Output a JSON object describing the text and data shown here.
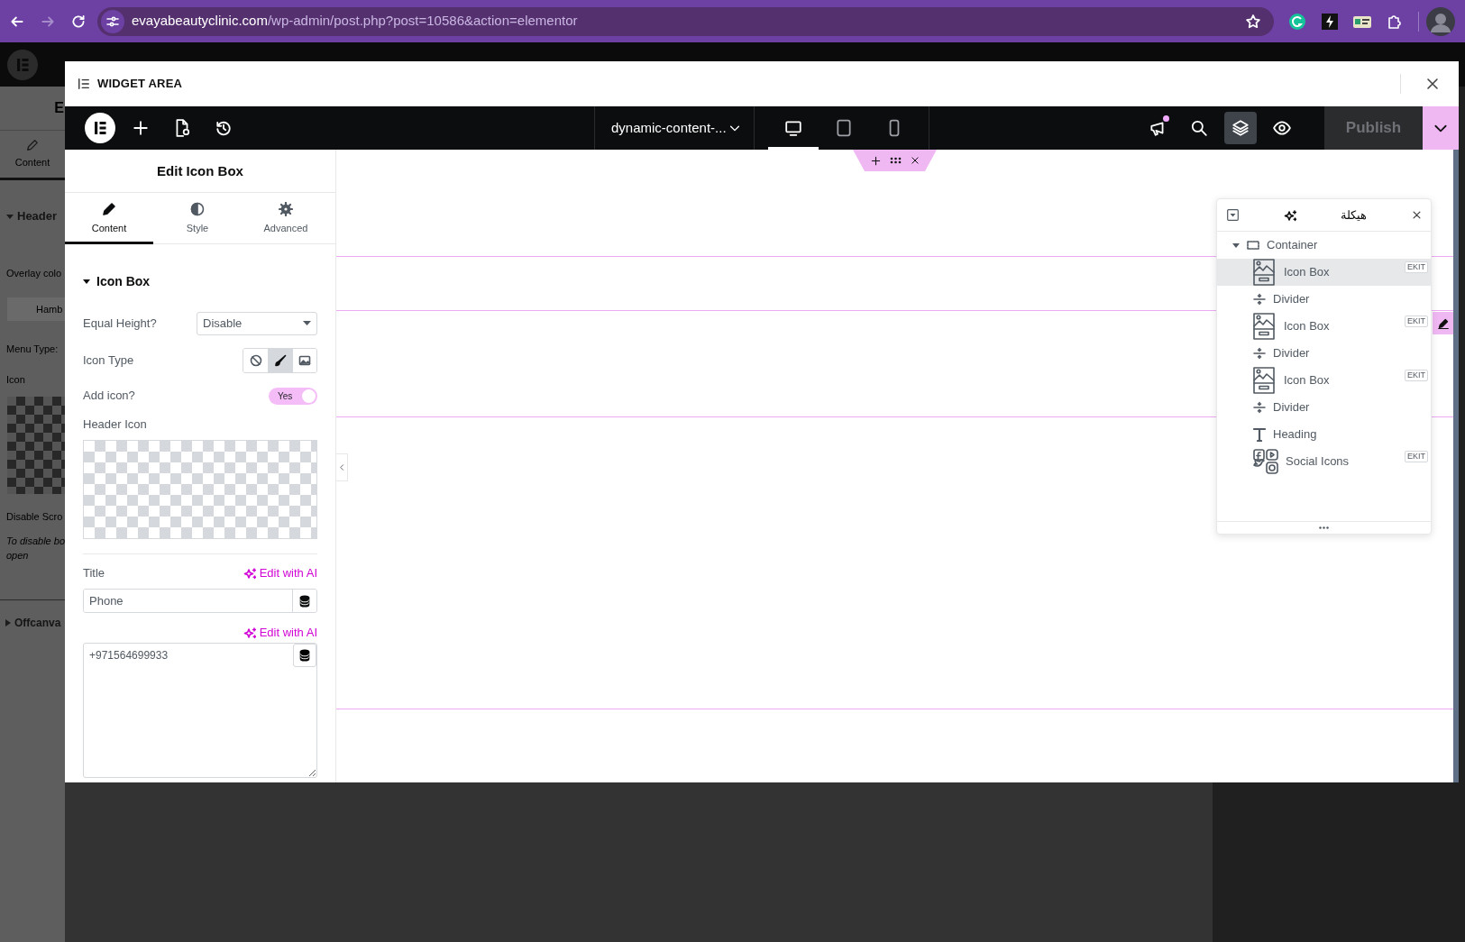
{
  "browser": {
    "url_host": "evayabeautyclinic.com",
    "url_path": "/wp-admin/post.php?post=10586&action=elementor"
  },
  "background_panel": {
    "title": "E",
    "tab": "Content",
    "section": "Header",
    "overlay_label": "Overlay colo",
    "menu_button": "Hamb",
    "menu_type_label": "Menu Type:",
    "icon_label": "Icon",
    "scroll_label": "Disable Scro",
    "hint_lines": [
      "To disable bo",
      "open"
    ],
    "next_section": "Offcanva"
  },
  "modal": {
    "title": "WIDGET AREA"
  },
  "toolbar": {
    "page_name": "dynamic-content-...",
    "devices": [
      {
        "kind": "desktop",
        "selected": true
      },
      {
        "kind": "tablet",
        "selected": false
      },
      {
        "kind": "mobile",
        "selected": false
      }
    ],
    "tools": [
      {
        "kind": "announcements",
        "badge": true,
        "selected": false
      },
      {
        "kind": "search",
        "badge": false,
        "selected": false
      },
      {
        "kind": "structure",
        "badge": false,
        "selected": true
      },
      {
        "kind": "preview",
        "badge": false,
        "selected": false
      }
    ],
    "publish": {
      "label": "Publish",
      "disabled": true
    }
  },
  "panel": {
    "title": "Edit Icon Box",
    "tabs": [
      {
        "label": "Content",
        "kind": "content",
        "selected": true
      },
      {
        "label": "Style",
        "kind": "style",
        "selected": false
      },
      {
        "label": "Advanced",
        "kind": "advanced",
        "selected": false
      }
    ],
    "section": {
      "title": "Icon Box",
      "expanded": true
    },
    "controls": [
      {
        "kind": "select",
        "label": "Equal Height?",
        "value": "Disable"
      },
      {
        "kind": "choices",
        "label": "Icon Type",
        "options": [
          {
            "kind": "none",
            "selected": false
          },
          {
            "kind": "icon",
            "selected": true
          },
          {
            "kind": "image",
            "selected": false
          }
        ]
      },
      {
        "kind": "switch",
        "label": "Add icon?",
        "on": true,
        "on_text": "Yes"
      },
      {
        "kind": "media",
        "label": "Header Icon"
      },
      {
        "kind": "text",
        "label": "Title",
        "ai_link": "Edit with AI",
        "value": "Phone"
      },
      {
        "kind": "textarea",
        "ai_link": "Edit with AI",
        "value": "+971564699933"
      }
    ]
  },
  "navigator": {
    "title": "هيكلة",
    "items": [
      {
        "label": "Container",
        "kind": "container",
        "expanded": true,
        "selected": false,
        "children": [
          {
            "label": "Icon Box",
            "kind": "icon-box",
            "selected": true,
            "badge": "EKIT"
          },
          {
            "label": "Divider",
            "kind": "divider",
            "selected": false
          },
          {
            "label": "Icon Box",
            "kind": "icon-box",
            "selected": false,
            "badge": "EKIT"
          },
          {
            "label": "Divider",
            "kind": "divider",
            "selected": false
          },
          {
            "label": "Icon Box",
            "kind": "icon-box",
            "selected": false,
            "badge": "EKIT"
          },
          {
            "label": "Divider",
            "kind": "divider",
            "selected": false
          },
          {
            "label": "Heading",
            "kind": "heading",
            "selected": false
          },
          {
            "label": "Social Icons",
            "kind": "social-icons",
            "selected": false,
            "badge": "EKIT"
          }
        ]
      }
    ]
  }
}
